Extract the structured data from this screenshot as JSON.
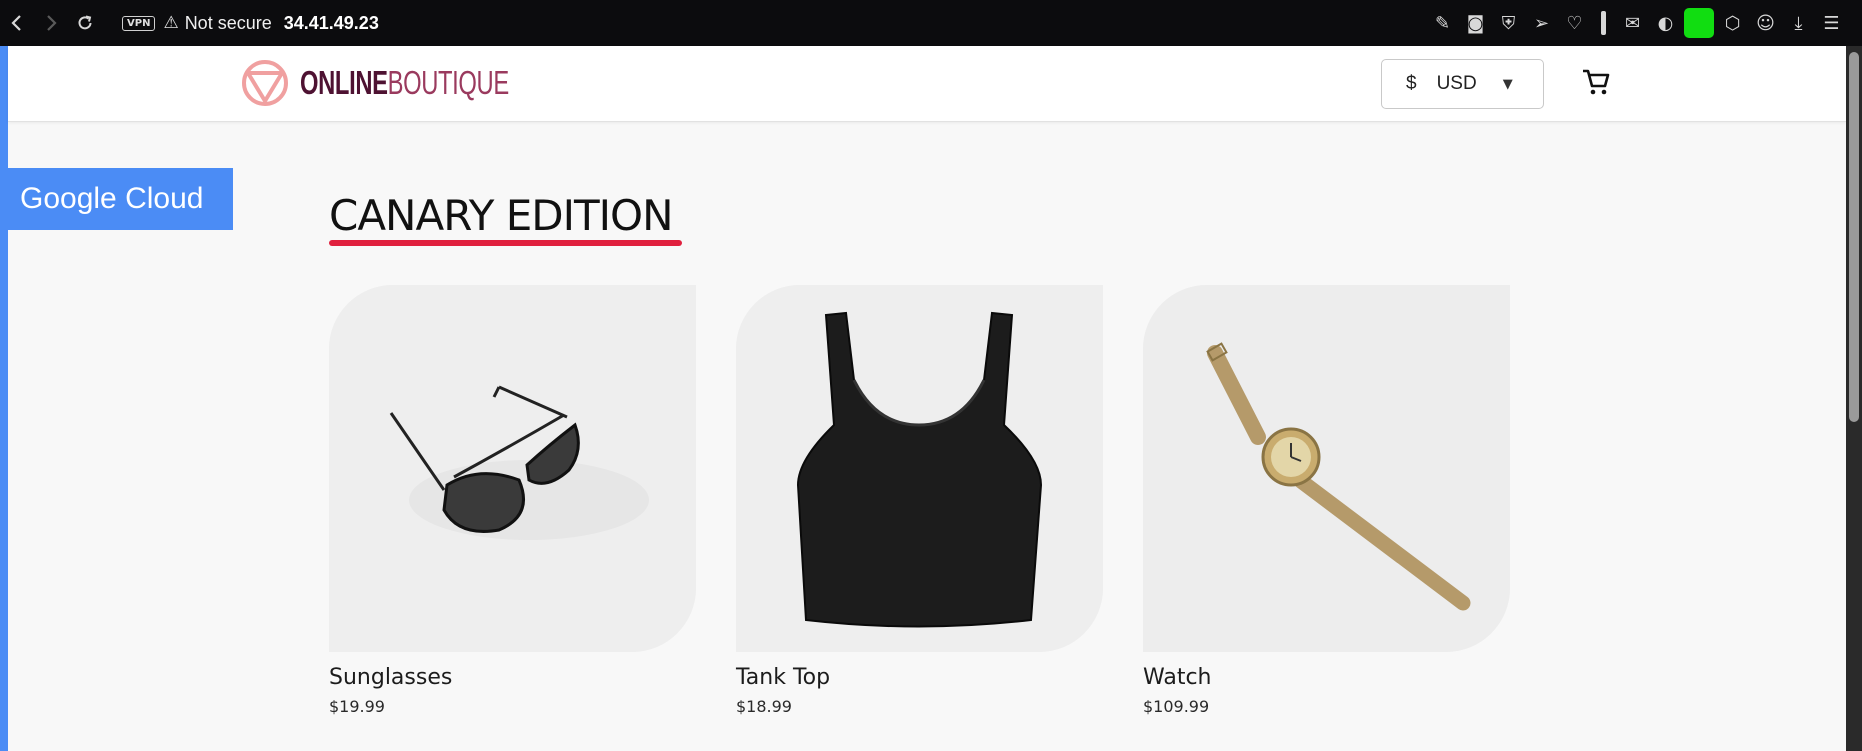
{
  "browser": {
    "back_icon": "chevron-left-icon",
    "forward_icon": "chevron-right-icon",
    "reload_icon": "reload-icon",
    "vpn_label": "VPN",
    "security_label": "Not secure",
    "url": "34.41.49.23"
  },
  "header": {
    "logo_bold": "ONLINE",
    "logo_light": "BOUTIQUE",
    "currency_symbol": "$",
    "currency_code": "USD"
  },
  "banner": {
    "label": "Google Cloud"
  },
  "main": {
    "title": "CANARY EDITION",
    "products": [
      {
        "name": "Sunglasses",
        "price": "$19.99"
      },
      {
        "name": "Tank Top",
        "price": "$18.99"
      },
      {
        "name": "Watch",
        "price": "$109.99"
      }
    ]
  },
  "colors": {
    "accent_blue": "#4b8cf5",
    "title_underline": "#e0203e",
    "logo_dark": "#4e1232",
    "logo_light": "#9a3a5e",
    "logo_mark": "#f0a0a0"
  }
}
